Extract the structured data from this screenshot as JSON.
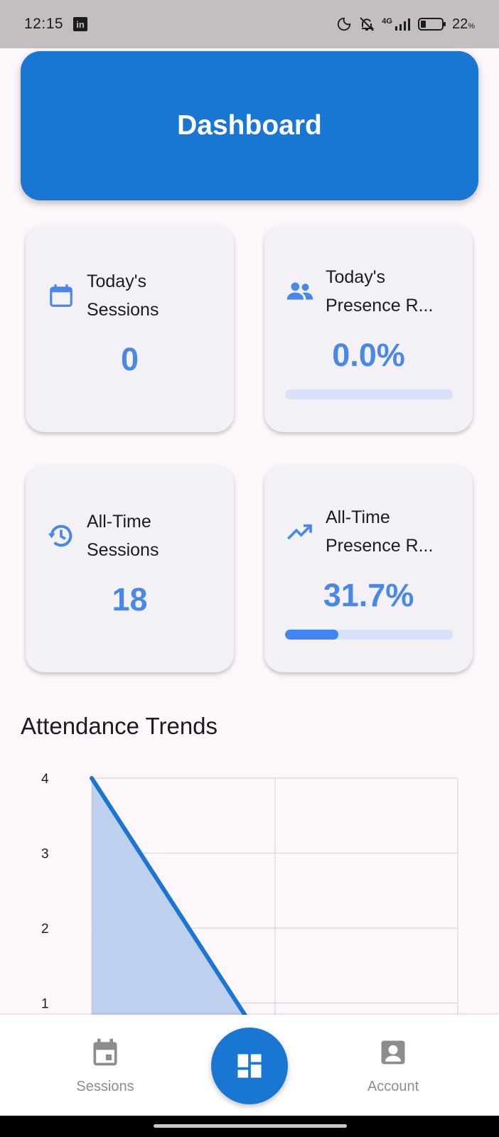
{
  "status_bar": {
    "time": "12:15",
    "app_badge": "in",
    "network": "4G",
    "battery": "22",
    "battery_unit": "%"
  },
  "header": {
    "title": "Dashboard"
  },
  "cards": [
    {
      "label_line1": "Today's",
      "label_line2": "Sessions",
      "value": "0",
      "icon": "calendar-icon"
    },
    {
      "label_line1": "Today's",
      "label_line2": "Presence R...",
      "value": "0.0%",
      "icon": "people-icon",
      "progress": 0.0
    },
    {
      "label_line1": "All-Time",
      "label_line2": "Sessions",
      "value": "18",
      "icon": "history-icon"
    },
    {
      "label_line1": "All-Time",
      "label_line2": "Presence R...",
      "value": "31.7%",
      "icon": "trending-up-icon",
      "progress": 0.317
    }
  ],
  "section": {
    "title": "Attendance Trends"
  },
  "chart_data": {
    "type": "area",
    "ylabel": "",
    "xlabel": "",
    "ylim": [
      0,
      4
    ],
    "y_ticks": [
      "4",
      "3",
      "2",
      "1"
    ],
    "x": [
      0,
      1
    ],
    "values": [
      4,
      0
    ],
    "grid": true,
    "colors": {
      "line": "#1976d2",
      "fill": "#b9cfed"
    }
  },
  "nav": {
    "sessions_label": "Sessions",
    "account_label": "Account"
  },
  "colors": {
    "primary": "#1976d2",
    "accent_value": "#4a88e8",
    "background": "#fdf7fc"
  }
}
